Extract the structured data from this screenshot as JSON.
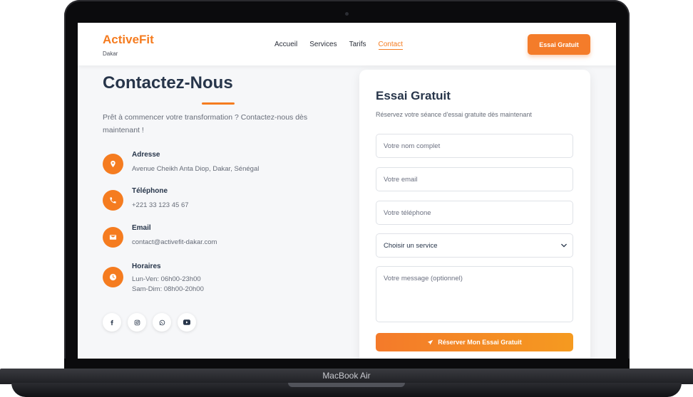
{
  "device": {
    "label": "MacBook Air"
  },
  "header": {
    "logo": "ActiveFit",
    "location": "Dakar",
    "nav": [
      "Accueil",
      "Services",
      "Tarifs",
      "Contact"
    ],
    "active_nav": "Contact",
    "cta": "Essai Gratuit"
  },
  "contact": {
    "title": "Contactez-Nous",
    "intro": "Prêt à commencer votre transformation ? Contactez-nous dès maintenant !",
    "items": [
      {
        "icon": "location-pin-icon",
        "title": "Adresse",
        "lines": [
          "Avenue Cheikh Anta Diop, Dakar, Sénégal"
        ]
      },
      {
        "icon": "phone-icon",
        "title": "Téléphone",
        "lines": [
          "+221 33 123 45 67"
        ]
      },
      {
        "icon": "envelope-icon",
        "title": "Email",
        "lines": [
          "contact@activefit-dakar.com"
        ]
      },
      {
        "icon": "clock-icon",
        "title": "Horaires",
        "lines": [
          "Lun-Ven: 06h00-23h00",
          "Sam-Dim: 08h00-20h00"
        ]
      }
    ],
    "socials": [
      "facebook-icon",
      "instagram-icon",
      "whatsapp-icon",
      "youtube-icon"
    ]
  },
  "form": {
    "title": "Essai Gratuit",
    "subtitle": "Réservez votre séance d'essai gratuite dès maintenant",
    "name_placeholder": "Votre nom complet",
    "email_placeholder": "Votre email",
    "phone_placeholder": "Votre téléphone",
    "service_selected": "Choisir un service",
    "message_placeholder": "Votre message (optionnel)",
    "submit": "Réserver Mon Essai Gratuit"
  },
  "colors": {
    "accent": "#f57c20",
    "heading": "#27354a",
    "body_text": "#666c78"
  }
}
